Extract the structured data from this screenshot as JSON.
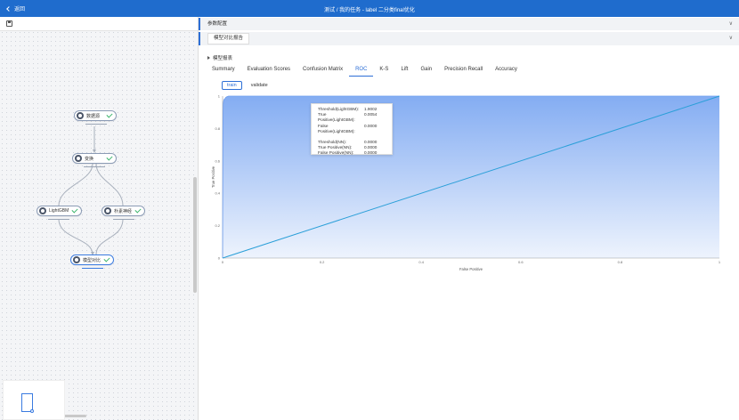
{
  "topbar": {
    "back_label": "返回",
    "title": "测试 / 我的任务 - label 二分类final优化"
  },
  "pipeline": {
    "nodes": [
      {
        "id": "n1",
        "label": "数据源"
      },
      {
        "id": "n2",
        "label": "变换"
      },
      {
        "id": "n3",
        "label": "LightGBM"
      },
      {
        "id": "n4",
        "label": "朴素神经"
      },
      {
        "id": "n5",
        "label": "模型对比"
      }
    ]
  },
  "panels": {
    "config_title": "参数配置",
    "report_tab": "模型对比报告",
    "section_title": "模型报表"
  },
  "tabs": [
    "Summary",
    "Evaluation Scores",
    "Confusion Matrix",
    "ROC",
    "K-S",
    "Lift",
    "Gain",
    "Precision Recall",
    "Accuracy"
  ],
  "active_tab": "ROC",
  "subtabs": [
    "train",
    "validate"
  ],
  "active_subtab": "train",
  "tooltip": {
    "group1": [
      {
        "k": "Threshold(LightGBM):",
        "v": "1.9002"
      },
      {
        "k": "True Positive(LightGBM):",
        "v": "0.0054"
      },
      {
        "k": "False Positive(LightGBM):",
        "v": "0.0000"
      }
    ],
    "group2": [
      {
        "k": "Threshold(NN):",
        "v": "0.0000"
      },
      {
        "k": "True Positive(NN):",
        "v": "0.0000"
      },
      {
        "k": "False Positive(NN):",
        "v": "0.0000"
      }
    ]
  },
  "colors": {
    "accent": "#2d6fd6",
    "topbar": "#1f6ccd",
    "success": "#3bb46b",
    "area": "#6e9ef0"
  },
  "chart_data": {
    "type": "area",
    "xlabel": "False Positive",
    "ylabel": "True Positive",
    "xlim": [
      0,
      1
    ],
    "ylim": [
      0,
      1
    ],
    "x_ticks": [
      "0",
      "0.2",
      "0.4",
      "0.6",
      "0.8",
      "1"
    ],
    "y_ticks": [
      "0",
      "0.2",
      "0.4",
      "0.6",
      "0.8",
      "1"
    ],
    "series": [
      {
        "x": [
          0,
          0.0006,
          0.0012,
          0.002,
          0.003,
          0.004,
          0.006,
          0.008,
          0.012,
          1
        ],
        "y": [
          0,
          0.8,
          0.95,
          0.97,
          0.98,
          0.98,
          0.99,
          0.995,
          1,
          1
        ]
      },
      {
        "x": [
          0,
          1
        ],
        "y": [
          0,
          1
        ]
      }
    ]
  }
}
